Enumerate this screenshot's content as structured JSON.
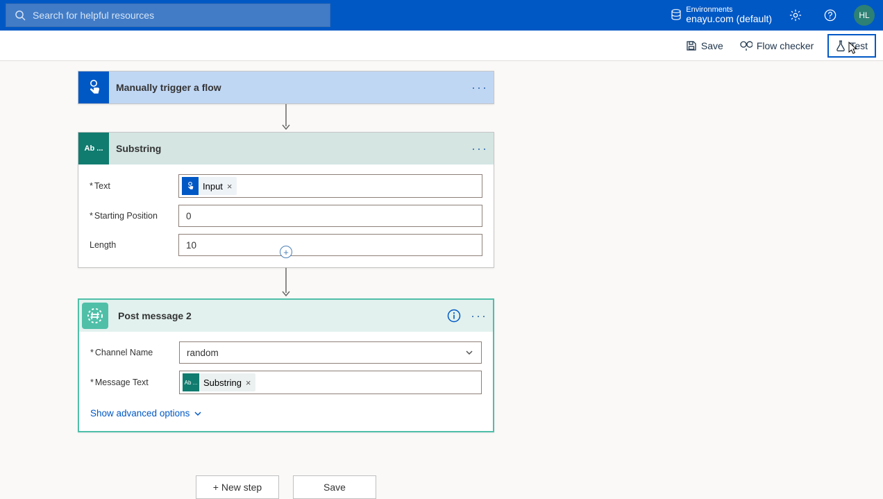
{
  "topbar": {
    "search_placeholder": "Search for helpful resources",
    "environments_label": "Environments",
    "environment_value": "enayu.com (default)",
    "avatar_initials": "HL"
  },
  "cmdbar": {
    "save": "Save",
    "flow_checker": "Flow checker",
    "test": "Test"
  },
  "steps": {
    "trigger": {
      "title": "Manually trigger a flow"
    },
    "substring": {
      "title": "Substring",
      "icon_text": "Ab ...",
      "fields": {
        "text_label": "Text",
        "text_token": "Input",
        "start_label": "Starting Position",
        "start_value": "0",
        "length_label": "Length",
        "length_value": "10"
      }
    },
    "post": {
      "title": "Post message 2",
      "fields": {
        "channel_label": "Channel Name",
        "channel_value": "random",
        "message_label": "Message Text",
        "message_token": "Substring",
        "message_token_icon": "Ab ..."
      },
      "advanced": "Show advanced options"
    }
  },
  "bottom": {
    "new_step": "+ New step",
    "save": "Save"
  },
  "req_marker": "*"
}
